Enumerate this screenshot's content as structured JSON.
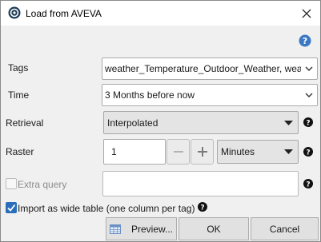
{
  "window": {
    "title": "Load from AVEVA"
  },
  "form": {
    "tags_label": "Tags",
    "tags_value": "weather_Temperature_Outdoor_Weather, weat",
    "time_label": "Time",
    "time_value": "3 Months before now",
    "retrieval_label": "Retrieval",
    "retrieval_value": "Interpolated",
    "raster_label": "Raster",
    "raster_value": "1",
    "raster_unit": "Minutes",
    "extra_query_label": "Extra query",
    "extra_query_value": "",
    "wide_table_label": "Import as wide table (one column per tag)"
  },
  "buttons": {
    "preview": "Preview...",
    "ok": "OK",
    "cancel": "Cancel"
  },
  "colors": {
    "accent": "#2a6ebb",
    "help_blue": "#3b78c4"
  },
  "icons": [
    "app-icon",
    "close-icon",
    "help-icon",
    "question-icon",
    "chevron-down-icon",
    "triangle-down-icon",
    "minus-icon",
    "plus-icon",
    "table-icon",
    "check-icon"
  ]
}
